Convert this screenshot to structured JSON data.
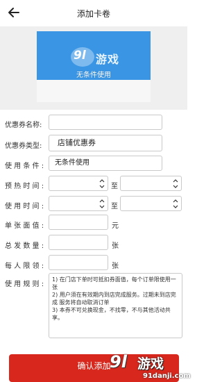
{
  "header": {
    "title": "添加卡卷"
  },
  "card_preview": {
    "text": "无条件使用",
    "watermark": "9l游戏"
  },
  "form": {
    "coupon_name": {
      "label": "优惠券名称:",
      "value": ""
    },
    "coupon_type": {
      "label": "优惠券类型:",
      "value": "店铺优惠券"
    },
    "usage_condition": {
      "label": "使 用 条 件 :",
      "value": "无条件使用"
    },
    "preheat_time": {
      "label": "预 热 时 间 :",
      "separator": "至"
    },
    "use_time": {
      "label": "使 用 时 间 :",
      "separator": "至"
    },
    "face_value": {
      "label": "单 张 面 值 :",
      "value": "",
      "unit": "元"
    },
    "total_issued": {
      "label": "总 发 数 量 :",
      "value": "",
      "unit": "张"
    },
    "per_person_limit": {
      "label": "每 人 限 领 :",
      "value": "",
      "unit": "张"
    },
    "usage_rules": {
      "label": "使 用 规 则 :",
      "value": "1) 在门店下单时可抵扣券面值，每个订单限使用一张\n2) 用户须在有效期内到店完成服务。过期未到店完成 服务将自动取消订单\n3) 本券不可兑换现金，不找零，不与其他活动共享。"
    }
  },
  "submit": {
    "label": "确认添加"
  },
  "watermark": {
    "logo": "9l",
    "name": "游戏",
    "site": "91danji.com"
  },
  "colors": {
    "card_blue": "#3a96e4",
    "submit_red": "#d8271c",
    "gray_bg": "#efefef"
  }
}
